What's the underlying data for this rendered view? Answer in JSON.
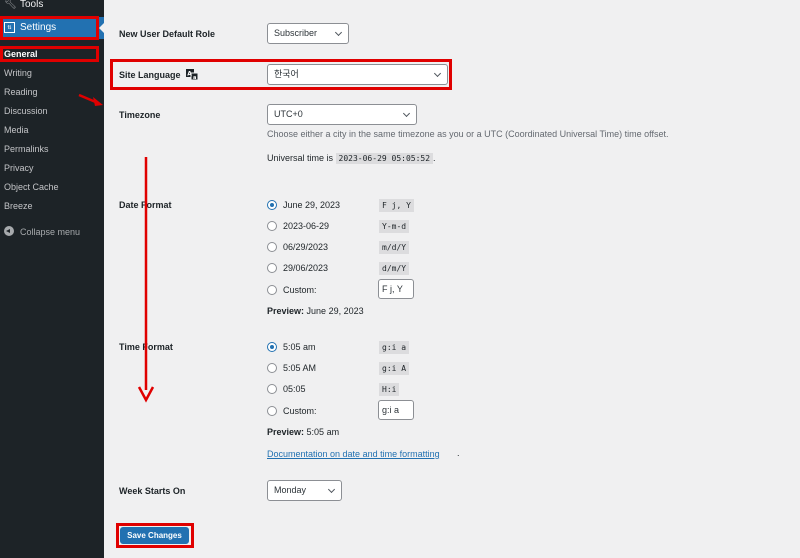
{
  "sidebar": {
    "tools": {
      "label": "Tools",
      "icon": "wrench-icon"
    },
    "settings": {
      "label": "Settings",
      "icon": "settings-icon",
      "icon_glyph": "⇅"
    },
    "items": [
      {
        "label": "General",
        "current": true
      },
      {
        "label": "Writing"
      },
      {
        "label": "Reading"
      },
      {
        "label": "Discussion"
      },
      {
        "label": "Media"
      },
      {
        "label": "Permalinks"
      },
      {
        "label": "Privacy"
      },
      {
        "label": "Object Cache"
      },
      {
        "label": "Breeze"
      }
    ],
    "collapse": {
      "label": "Collapse menu",
      "icon": "collapse-icon"
    }
  },
  "form": {
    "default_role": {
      "label": "New User Default Role",
      "value": "Subscriber"
    },
    "site_language": {
      "label": "Site Language",
      "value": "한국어",
      "icon": "translation-icon"
    },
    "timezone": {
      "label": "Timezone",
      "value": "UTC+0",
      "description": "Choose either a city in the same timezone as you or a UTC (Coordinated Universal Time) time offset.",
      "universal_prefix": "Universal time is",
      "universal_value": "2023-06-29 05:05:52",
      "universal_suffix": "."
    },
    "date_format": {
      "label": "Date Format",
      "options": [
        {
          "label": "June 29, 2023",
          "code": "F j, Y",
          "checked": true
        },
        {
          "label": "2023-06-29",
          "code": "Y-m-d",
          "checked": false
        },
        {
          "label": "06/29/2023",
          "code": "m/d/Y",
          "checked": false
        },
        {
          "label": "29/06/2023",
          "code": "d/m/Y",
          "checked": false
        }
      ],
      "custom_label": "Custom:",
      "custom_value": "F j, Y",
      "preview_label": "Preview:",
      "preview_value": "June 29, 2023"
    },
    "time_format": {
      "label": "Time Format",
      "options": [
        {
          "label": "5:05 am",
          "code": "g:i a",
          "checked": true
        },
        {
          "label": "5:05 AM",
          "code": "g:i A",
          "checked": false
        },
        {
          "label": "05:05",
          "code": "H:i",
          "checked": false
        }
      ],
      "custom_label": "Custom:",
      "custom_value": "g:i a",
      "preview_label": "Preview:",
      "preview_value": "5:05 am",
      "doc_link": "Documentation on date and time formatting",
      "doc_suffix": "."
    },
    "week_starts": {
      "label": "Week Starts On",
      "value": "Monday"
    },
    "save_label": "Save Changes"
  },
  "annotation": {
    "color": "#e00000"
  },
  "colors": {
    "accent": "#2271b1",
    "sidebar_bg": "#1d2327",
    "page_bg": "#f0f0f1"
  }
}
